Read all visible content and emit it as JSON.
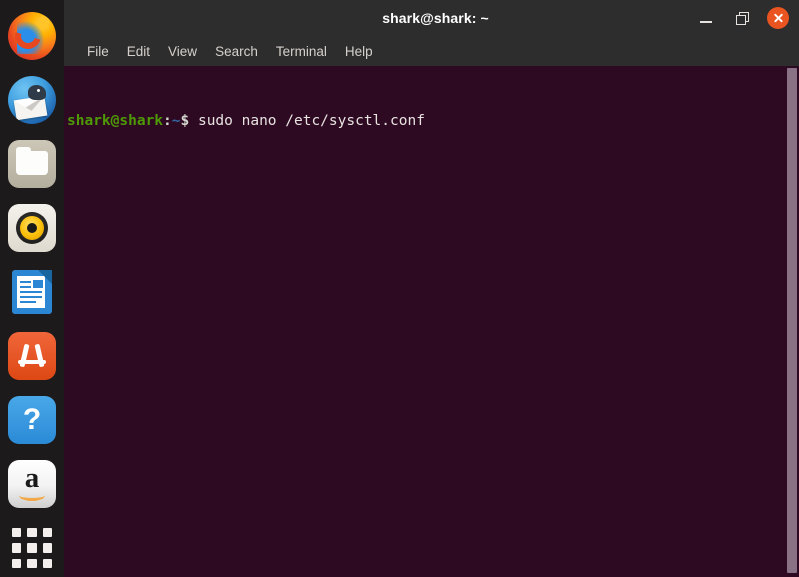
{
  "launcher": {
    "items": [
      {
        "name": "firefox",
        "label": "Firefox Web Browser"
      },
      {
        "name": "thunderbird",
        "label": "Thunderbird Mail"
      },
      {
        "name": "files",
        "label": "Files"
      },
      {
        "name": "rhythmbox",
        "label": "Rhythmbox"
      },
      {
        "name": "libreoffice-writer",
        "label": "LibreOffice Writer"
      },
      {
        "name": "ubuntu-software",
        "label": "Ubuntu Software"
      },
      {
        "name": "help",
        "label": "Help",
        "glyph": "?"
      },
      {
        "name": "amazon",
        "label": "Amazon",
        "glyph": "a"
      },
      {
        "name": "show-applications",
        "label": "Show Applications"
      }
    ]
  },
  "window": {
    "title": "shark@shark: ~",
    "controls": {
      "minimize": "minimize-icon",
      "maximize": "maximize-icon",
      "close": "close-icon"
    },
    "menubar": [
      {
        "label": "File"
      },
      {
        "label": "Edit"
      },
      {
        "label": "View"
      },
      {
        "label": "Search"
      },
      {
        "label": "Terminal"
      },
      {
        "label": "Help"
      }
    ]
  },
  "terminal": {
    "lines": [
      {
        "prompt_user": "shark@shark",
        "prompt_colon": ":",
        "prompt_path": "~",
        "prompt_sigil": "$",
        "command": " sudo nano /etc/sysctl.conf"
      }
    ],
    "scrollbar": "vertical-scrollbar"
  },
  "colors": {
    "launcher_bg": "#1d1a1b",
    "titlebar_bg": "#2d2d2d",
    "terminal_bg": "#2d0922",
    "close_button": "#e95420",
    "prompt_green": "#4e9a06",
    "prompt_blue": "#3465a4",
    "menu_text": "#d6d0cc",
    "scrollbar_thumb": "#8a7285"
  }
}
